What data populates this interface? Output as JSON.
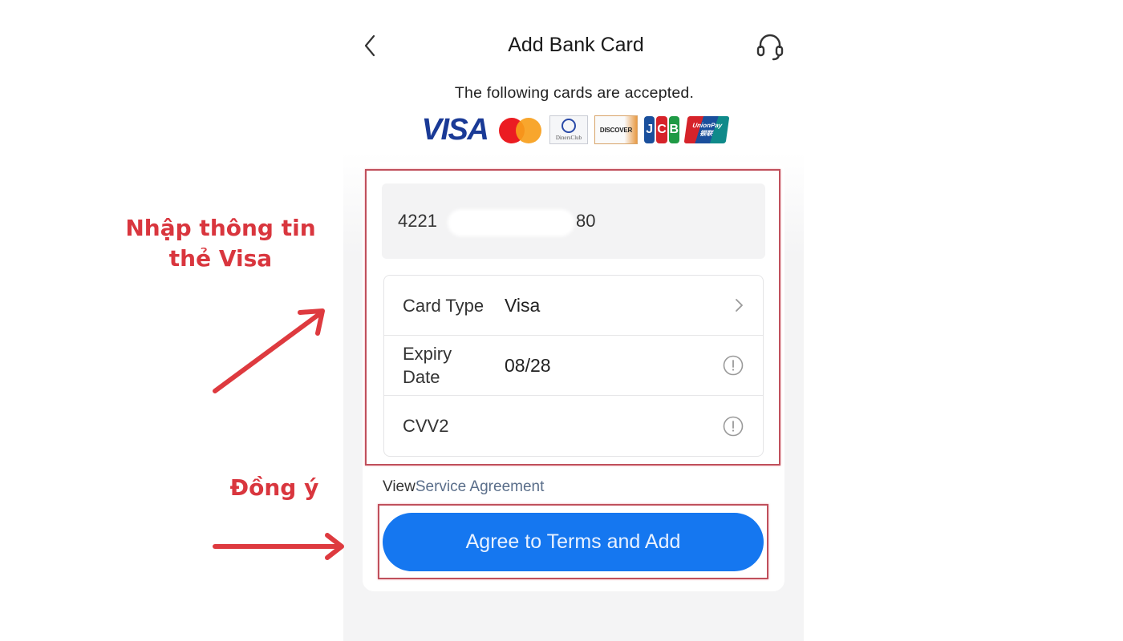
{
  "header": {
    "title": "Add Bank Card",
    "back_icon": "chevron-left-icon",
    "support_icon": "headset-icon"
  },
  "accepted": {
    "text": "The following cards are accepted.",
    "logos": [
      "VISA",
      "Mastercard",
      "Diners Club",
      "DISCOVER",
      "JCB",
      "UnionPay"
    ],
    "diners_text": "DinersClub",
    "discover_text": "DISCOVER",
    "jcb_letters": [
      "J",
      "C",
      "B"
    ],
    "unionpay_text": "UnionPay",
    "unionpay_sub": "银联"
  },
  "form": {
    "card_number_start": "4221",
    "card_number_end": "80",
    "rows": [
      {
        "label": "Card Type",
        "value": "Visa",
        "icon": "chevron-right-icon"
      },
      {
        "label": "Expiry\nDate",
        "value": "08/28",
        "icon": "info-circle-icon"
      },
      {
        "label": "CVV2",
        "value": "",
        "icon": "info-circle-icon"
      }
    ]
  },
  "agreement": {
    "prefix": "View",
    "link": "Service Agreement"
  },
  "submit": {
    "label": "Agree to Terms and Add"
  },
  "annotations": {
    "enter_info": "Nhập thông tin\nthẻ Visa",
    "agree": "Đồng ý"
  },
  "colors": {
    "primary_button": "#1577f0",
    "annotation_red": "#d9363e",
    "link": "#5a6e8a"
  }
}
